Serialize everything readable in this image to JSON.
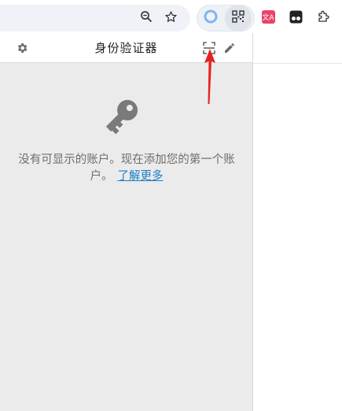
{
  "browser": {
    "omnibox_icons": [
      "zoom-icon",
      "bookmark-star-icon"
    ],
    "extension_icons": [
      "extension-circle-icon",
      "qr-scanner-extension-icon",
      "translate-extension-icon",
      "tampermonkey-icon",
      "extensions-puzzle-icon"
    ],
    "translate_badge_text": "文A"
  },
  "popup": {
    "title": "身份验证器",
    "settings_icon": "gear-icon",
    "scan_icon": "scan-qr-icon",
    "edit_icon": "pencil-icon",
    "empty_state": {
      "icon": "key-icon",
      "message": "没有可显示的账户。现在添加您的第一个账户。",
      "link_text": "了解更多"
    }
  },
  "annotation": {
    "arrow_color": "#e8201f"
  }
}
